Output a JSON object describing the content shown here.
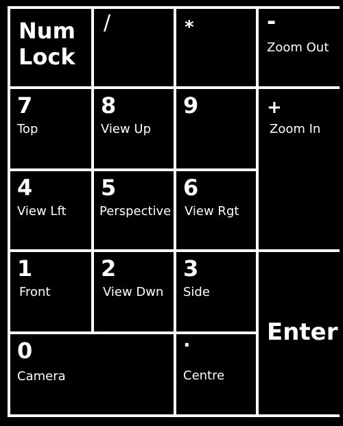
{
  "keys": {
    "numlock": {
      "line1": "Num",
      "line2": "Lock"
    },
    "slash": {
      "label": "/"
    },
    "star": {
      "label": "*"
    },
    "minus": {
      "label": "-",
      "action": "Zoom Out"
    },
    "k7": {
      "label": "7",
      "action": "Top"
    },
    "k8": {
      "label": "8",
      "action": "View Up"
    },
    "k9": {
      "label": "9",
      "action": ""
    },
    "plus": {
      "label": "+",
      "action": "Zoom In"
    },
    "k4": {
      "label": "4",
      "action": "View Lft"
    },
    "k5": {
      "label": "5",
      "action": "Perspective"
    },
    "k6": {
      "label": "6",
      "action": "View Rgt"
    },
    "k1": {
      "label": "1",
      "action": "Front"
    },
    "k2": {
      "label": "2",
      "action": "View Dwn"
    },
    "k3": {
      "label": "3",
      "action": "Side"
    },
    "enter": {
      "label": "Enter"
    },
    "k0": {
      "label": "0",
      "action": "Camera"
    },
    "dot": {
      "label": "·",
      "action": "Centre"
    }
  },
  "colors": {
    "background": "#000000",
    "border": "#ffffff",
    "text": "#ffffff"
  }
}
